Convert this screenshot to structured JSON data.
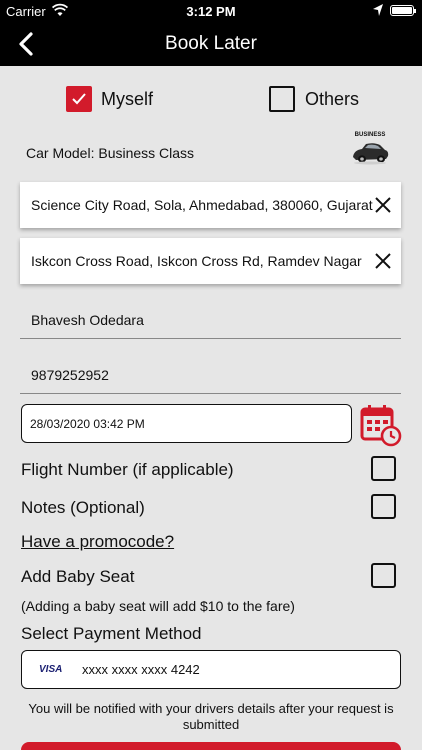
{
  "status_bar": {
    "carrier": "Carrier",
    "time": "3:12 PM"
  },
  "header": {
    "title": "Book Later"
  },
  "booking_for": {
    "myself": {
      "label": "Myself",
      "checked": true
    },
    "others": {
      "label": "Others",
      "checked": false
    }
  },
  "car": {
    "model_label": "Car Model: Business Class",
    "badge": "BUSINESS"
  },
  "pickup": {
    "value": "Science City Road, Sola, Ahmedabad, 380060, Gujarat"
  },
  "dropoff": {
    "value": "Iskcon Cross Road, Iskcon Cross Rd, Ramdev Nagar"
  },
  "passenger": {
    "name": "Bhavesh Odedara",
    "phone": "9879252952"
  },
  "schedule": {
    "datetime": "28/03/2020 03:42 PM"
  },
  "options": {
    "flight_label": "Flight Number (if applicable)",
    "notes_label": "Notes (Optional)",
    "promo_link": "Have a promocode?",
    "baby_seat_label": "Add Baby Seat",
    "baby_seat_note": "(Adding a baby seat will add $10 to the fare)"
  },
  "payment": {
    "title": "Select Payment Method",
    "brand": "VISA",
    "card_number": "xxxx xxxx xxxx 4242"
  },
  "notice": "You will be notified with your drivers details after your request is submitted",
  "colors": {
    "accent": "#d21b2b",
    "background": "#e6e6e6",
    "header": "#000000"
  }
}
